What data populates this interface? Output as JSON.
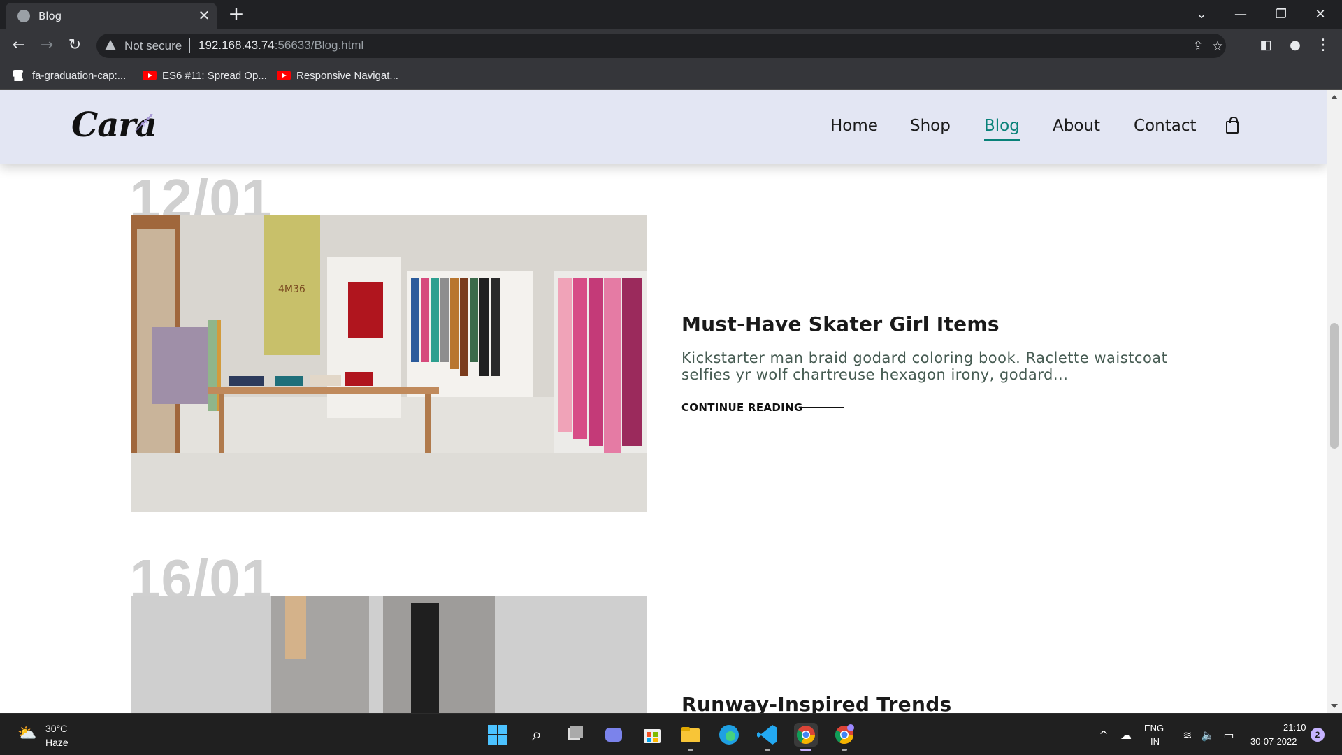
{
  "browser": {
    "tab_title": "Blog",
    "tab_close": "✕",
    "new_tab": "+",
    "not_secure": "Not secure",
    "url_host": "192.168.43.74",
    "url_path": ":56633/Blog.html",
    "bookmarks": [
      {
        "label": "fa-graduation-cap:...",
        "icon": "flag-icon"
      },
      {
        "label": "ES6 #11: Spread Op...",
        "icon": "youtube-icon"
      },
      {
        "label": "Responsive Navigat...",
        "icon": "youtube-icon"
      }
    ]
  },
  "site": {
    "logo": "Cara",
    "nav": [
      "Home",
      "Shop",
      "Blog",
      "About",
      "Contact"
    ],
    "active_nav": "Blog",
    "accent_color": "#088178",
    "header_bg": "#e3e6f3"
  },
  "posts": [
    {
      "date": "12/01",
      "title": "Must-Have Skater Girl Items",
      "excerpt": "Kickstarter man braid godard coloring book. Raclette waistcoat selfies yr wolf chartreuse hexagon irony, godard...",
      "cta": "CONTINUE READING"
    },
    {
      "date": "16/01",
      "title": "Runway-Inspired Trends"
    }
  ],
  "store_sign": "4M36",
  "taskbar": {
    "weather_temp": "30°C",
    "weather_desc": "Haze",
    "lang_top": "ENG",
    "lang_bottom": "IN",
    "time": "21:10",
    "date": "30-07-2022",
    "notifications": "2"
  }
}
